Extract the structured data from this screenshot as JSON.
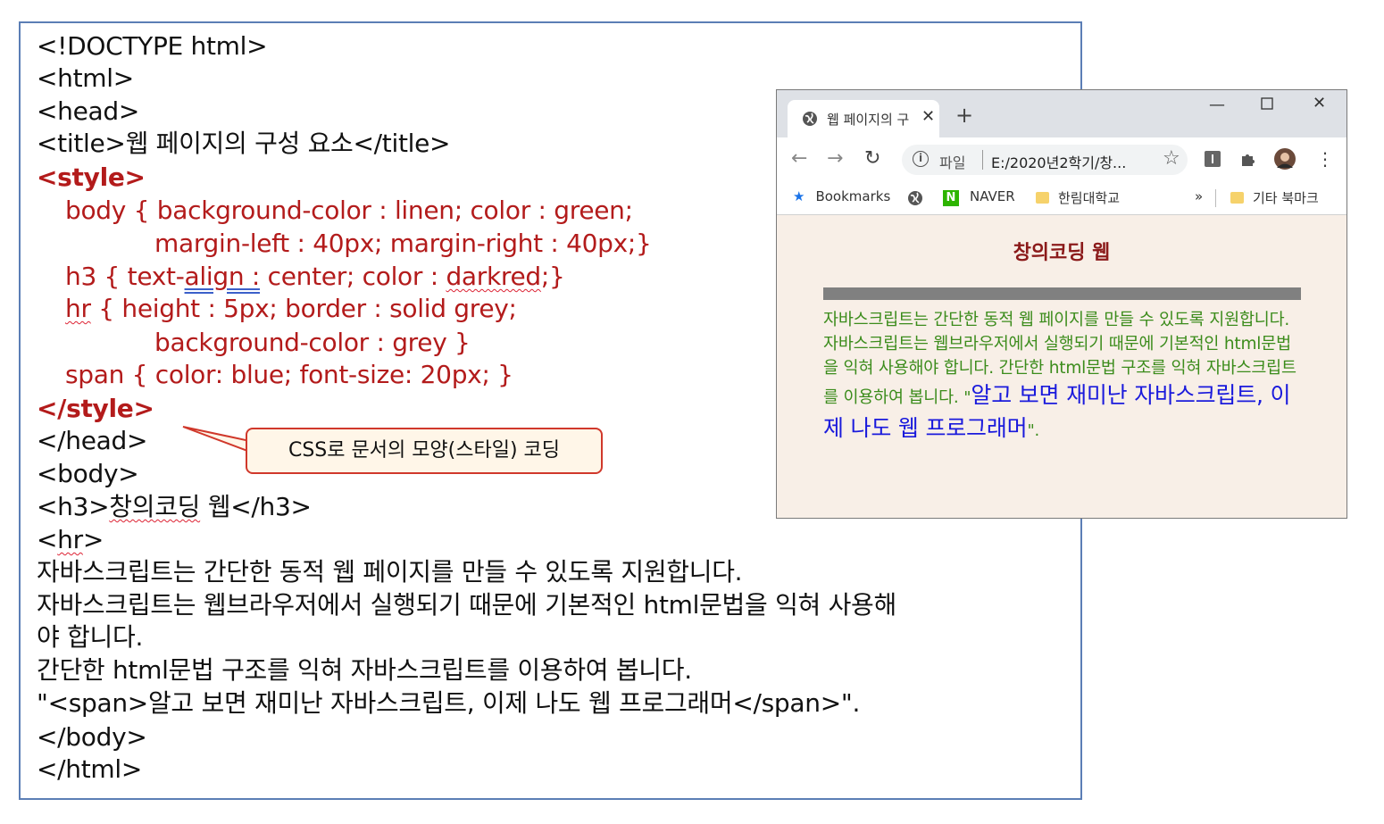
{
  "code": {
    "doctype": "<!DOCTYPE html>",
    "html_open": "<html>",
    "head_open": "<head>",
    "title_line": "<title>웹 페이지의 구성 요소</title>",
    "style_open": "<style>",
    "css_body_1": "body { background-color : linen; color : green;",
    "css_body_2": "margin-left : 40px; margin-right : 40px;}",
    "css_h3_a": "h3 { text-",
    "css_h3_b": "align :",
    "css_h3_c": " center; color : ",
    "css_h3_d": "darkred",
    "css_h3_e": ";}",
    "css_hr_a": "hr",
    "css_hr_b": " { height : 5px; border : solid grey;",
    "css_hr_2": "background-color : grey }",
    "css_span": "span { color: blue; font-size: 20px; }",
    "style_close": "</style>",
    "head_close": "</head>",
    "body_open": "<body>",
    "h3_a": "<h3>",
    "h3_b": "창의코딩",
    "h3_c": " 웹</h3>",
    "hr_a": "<",
    "hr_b": "hr",
    "hr_c": ">",
    "text_1": "자바스크립트는 간단한 동적 웹 페이지를 만들 수 있도록 지원합니다.",
    "text_2": "자바스크립트는 웹브라우저에서 실행되기 때문에 기본적인 html문법을 익혀 사용해",
    "text_3": "야 합니다.",
    "text_4": "간단한 html문법 구조를 익혀 자바스크립트를 이용하여 봅니다.",
    "text_5": "\"<span>알고 보면 재미난 자바스크립트, 이제 나도 웹 프로그래머</span>\".",
    "body_close": "</body>",
    "html_close": "</html>"
  },
  "callout": {
    "text": "CSS로 문서의 모양(스타일) 코딩"
  },
  "browser": {
    "tab_title": "웹 페이지의 구",
    "new_tab": "+",
    "address_file_label": "파일",
    "address_url": "E:/2020년2학기/창...",
    "bookmarks": {
      "bookmarks_label": "Bookmarks",
      "naver_label": "NAVER",
      "hallym_label": "한림대학교",
      "more": "»",
      "other_label": "기타 북마크"
    },
    "page": {
      "h3": "창의코딩 웹",
      "paragraph": "자바스크립트는 간단한 동적 웹 페이지를 만들 수 있도록 지원합니다. 자바스크립트는 웹브라우저에서 실행되기 때문에 기본적인 html문법을 익혀 사용해야 합니다. 간단한 html문법 구조를 익혀 자바스크립트를 이용하여 봅니다.",
      "quote_open": "\"",
      "span_text": "알고 보면 재미난 자바스크립트, 이제 나도 웹 프로그래머",
      "quote_close": "\"."
    }
  },
  "colors": {
    "code_red": "#b31b1b",
    "page_bg_linen": "#f8efe7",
    "page_text_green": "#3c8c1c",
    "page_h3_darkred": "#8b1a1a",
    "page_span_blue": "#1a1adc"
  }
}
